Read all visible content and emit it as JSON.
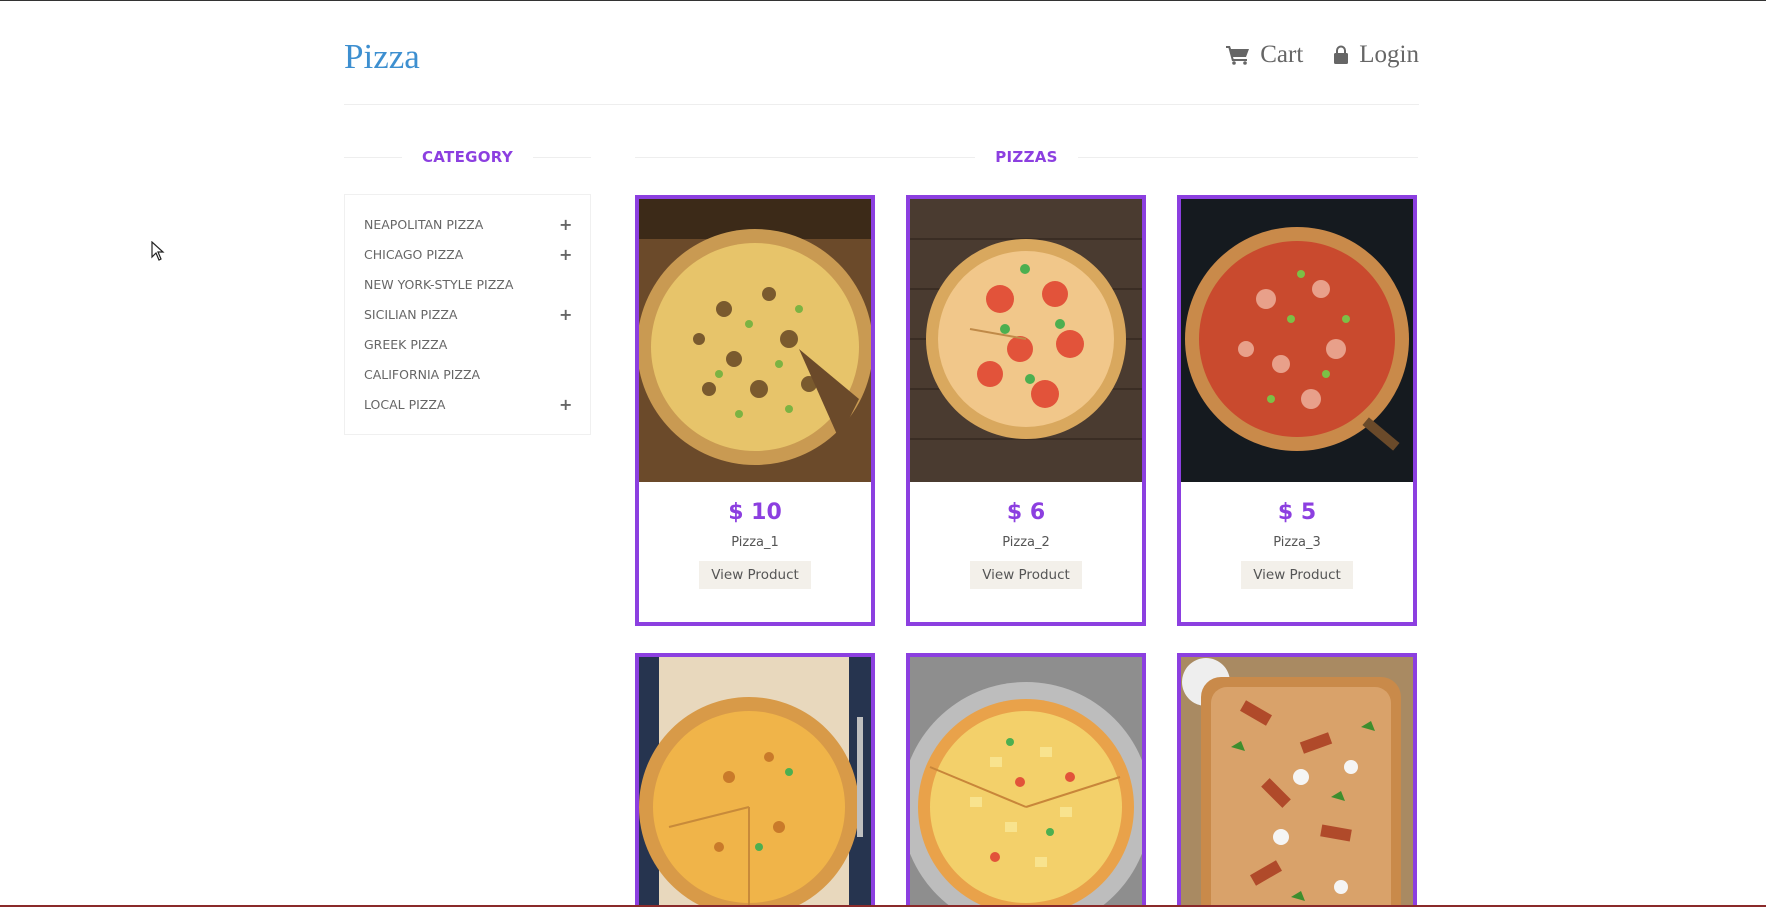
{
  "header": {
    "logo": "Pizza",
    "cart_label": "Cart",
    "login_label": "Login"
  },
  "category": {
    "title": "CATEGORY",
    "items": [
      {
        "label": "NEAPOLITAN PIZZA",
        "expandable": true
      },
      {
        "label": "CHICAGO PIZZA",
        "expandable": true
      },
      {
        "label": "NEW YORK-STYLE PIZZA",
        "expandable": false
      },
      {
        "label": "SICILIAN PIZZA",
        "expandable": true
      },
      {
        "label": "GREEK PIZZA",
        "expandable": false
      },
      {
        "label": "CALIFORNIA PIZZA",
        "expandable": false
      },
      {
        "label": "LOCAL PIZZA",
        "expandable": true
      }
    ]
  },
  "pizzas": {
    "title": "PIZZAS",
    "products": [
      {
        "price": "$ 10",
        "name": "Pizza_1",
        "button": "View Product"
      },
      {
        "price": "$ 6",
        "name": "Pizza_2",
        "button": "View Product"
      },
      {
        "price": "$ 5",
        "name": "Pizza_3",
        "button": "View Product"
      },
      {
        "price": "",
        "name": "",
        "button": ""
      },
      {
        "price": "",
        "name": "",
        "button": ""
      },
      {
        "price": "",
        "name": "",
        "button": ""
      }
    ]
  },
  "colors": {
    "accent": "#8c3fe0",
    "logo": "#3d8fd0",
    "button_bg": "#f3f0ea"
  }
}
